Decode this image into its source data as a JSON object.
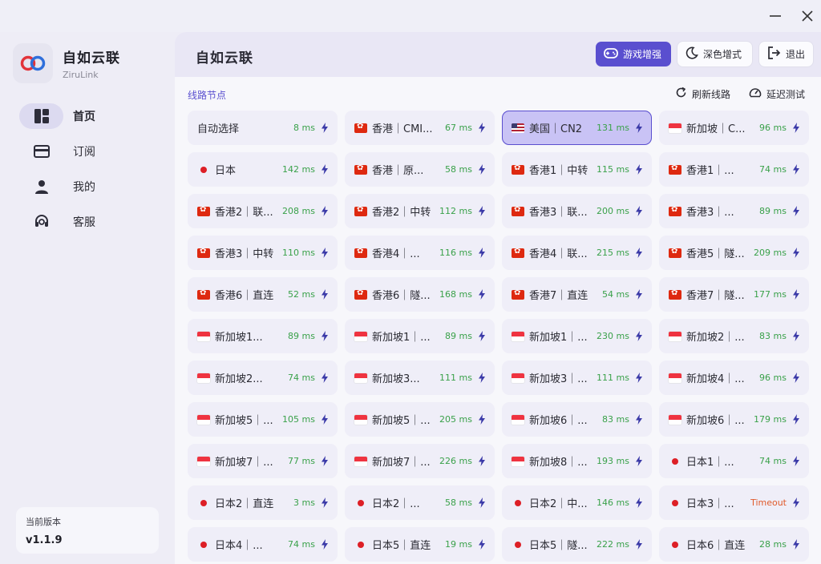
{
  "app": {
    "name": "自如云联",
    "subtitle": "ZiruLink"
  },
  "nav": [
    {
      "label": "首页",
      "icon": "dashboard-icon",
      "active": true
    },
    {
      "label": "订阅",
      "icon": "card-icon",
      "active": false
    },
    {
      "label": "我的",
      "icon": "user-icon",
      "active": false
    },
    {
      "label": "客服",
      "icon": "headset-icon",
      "active": false
    }
  ],
  "version": {
    "label": "当前版本",
    "value": "v1.1.9"
  },
  "header": {
    "title": "自如云联",
    "game_label": "游戏增强",
    "dark_label": "深色增式",
    "exit_label": "退出"
  },
  "section": {
    "title": "线路节点",
    "refresh_label": "刷新线路",
    "latency_label": "延迟测试"
  },
  "colors": {
    "accent": "#5a4fcf",
    "latency_ok": "#3aa14a",
    "latency_timeout": "#e05a2b"
  },
  "nodes": [
    {
      "flag": "",
      "name": "自动选择",
      "latency": "8 ms"
    },
    {
      "flag": "hk",
      "name": "香港｜CMI...",
      "latency": "67 ms"
    },
    {
      "flag": "us",
      "name": "美国｜CN2",
      "latency": "131 ms",
      "selected": true
    },
    {
      "flag": "sg",
      "name": "新加坡｜C...",
      "latency": "96 ms"
    },
    {
      "flag": "jp",
      "name": "日本",
      "latency": "142 ms"
    },
    {
      "flag": "hk",
      "name": "香港｜原...",
      "latency": "58 ms"
    },
    {
      "flag": "hk",
      "name": "香港1｜中转",
      "latency": "115 ms"
    },
    {
      "flag": "hk",
      "name": "香港1｜...",
      "latency": "74 ms"
    },
    {
      "flag": "hk",
      "name": "香港2｜联...",
      "latency": "208 ms"
    },
    {
      "flag": "hk",
      "name": "香港2｜中转",
      "latency": "112 ms"
    },
    {
      "flag": "hk",
      "name": "香港3｜联...",
      "latency": "200 ms"
    },
    {
      "flag": "hk",
      "name": "香港3｜...",
      "latency": "89 ms"
    },
    {
      "flag": "hk",
      "name": "香港3｜中转",
      "latency": "110 ms"
    },
    {
      "flag": "hk",
      "name": "香港4｜...",
      "latency": "116 ms"
    },
    {
      "flag": "hk",
      "name": "香港4｜联...",
      "latency": "215 ms"
    },
    {
      "flag": "hk",
      "name": "香港5｜隧...",
      "latency": "209 ms"
    },
    {
      "flag": "hk",
      "name": "香港6｜直连",
      "latency": "52 ms"
    },
    {
      "flag": "hk",
      "name": "香港6｜隧...",
      "latency": "168 ms"
    },
    {
      "flag": "hk",
      "name": "香港7｜直连",
      "latency": "54 ms"
    },
    {
      "flag": "hk",
      "name": "香港7｜隧...",
      "latency": "177 ms"
    },
    {
      "flag": "sg",
      "name": "新加坡1...",
      "latency": "89 ms"
    },
    {
      "flag": "sg",
      "name": "新加坡1｜...",
      "latency": "89 ms"
    },
    {
      "flag": "sg",
      "name": "新加坡1｜...",
      "latency": "230 ms"
    },
    {
      "flag": "sg",
      "name": "新加坡2｜...",
      "latency": "83 ms"
    },
    {
      "flag": "sg",
      "name": "新加坡2...",
      "latency": "74 ms"
    },
    {
      "flag": "sg",
      "name": "新加坡3...",
      "latency": "111 ms"
    },
    {
      "flag": "sg",
      "name": "新加坡3｜...",
      "latency": "111 ms"
    },
    {
      "flag": "sg",
      "name": "新加坡4｜...",
      "latency": "96 ms"
    },
    {
      "flag": "sg",
      "name": "新加坡5｜...",
      "latency": "105 ms"
    },
    {
      "flag": "sg",
      "name": "新加坡5｜...",
      "latency": "205 ms"
    },
    {
      "flag": "sg",
      "name": "新加坡6｜...",
      "latency": "83 ms"
    },
    {
      "flag": "sg",
      "name": "新加坡6｜...",
      "latency": "179 ms"
    },
    {
      "flag": "sg",
      "name": "新加坡7｜...",
      "latency": "77 ms"
    },
    {
      "flag": "sg",
      "name": "新加坡7｜...",
      "latency": "226 ms"
    },
    {
      "flag": "sg",
      "name": "新加坡8｜...",
      "latency": "193 ms"
    },
    {
      "flag": "jp",
      "name": "日本1｜...",
      "latency": "74 ms"
    },
    {
      "flag": "jp",
      "name": "日本2｜直连",
      "latency": "3 ms"
    },
    {
      "flag": "jp",
      "name": "日本2｜...",
      "latency": "58 ms"
    },
    {
      "flag": "jp",
      "name": "日本2｜中...",
      "latency": "146 ms"
    },
    {
      "flag": "jp",
      "name": "日本3｜...",
      "latency": "Timeout",
      "timeout": true
    },
    {
      "flag": "jp",
      "name": "日本4｜...",
      "latency": "74 ms"
    },
    {
      "flag": "jp",
      "name": "日本5｜直连",
      "latency": "19 ms"
    },
    {
      "flag": "jp",
      "name": "日本5｜隧...",
      "latency": "222 ms"
    },
    {
      "flag": "jp",
      "name": "日本6｜直连",
      "latency": "28 ms"
    }
  ]
}
